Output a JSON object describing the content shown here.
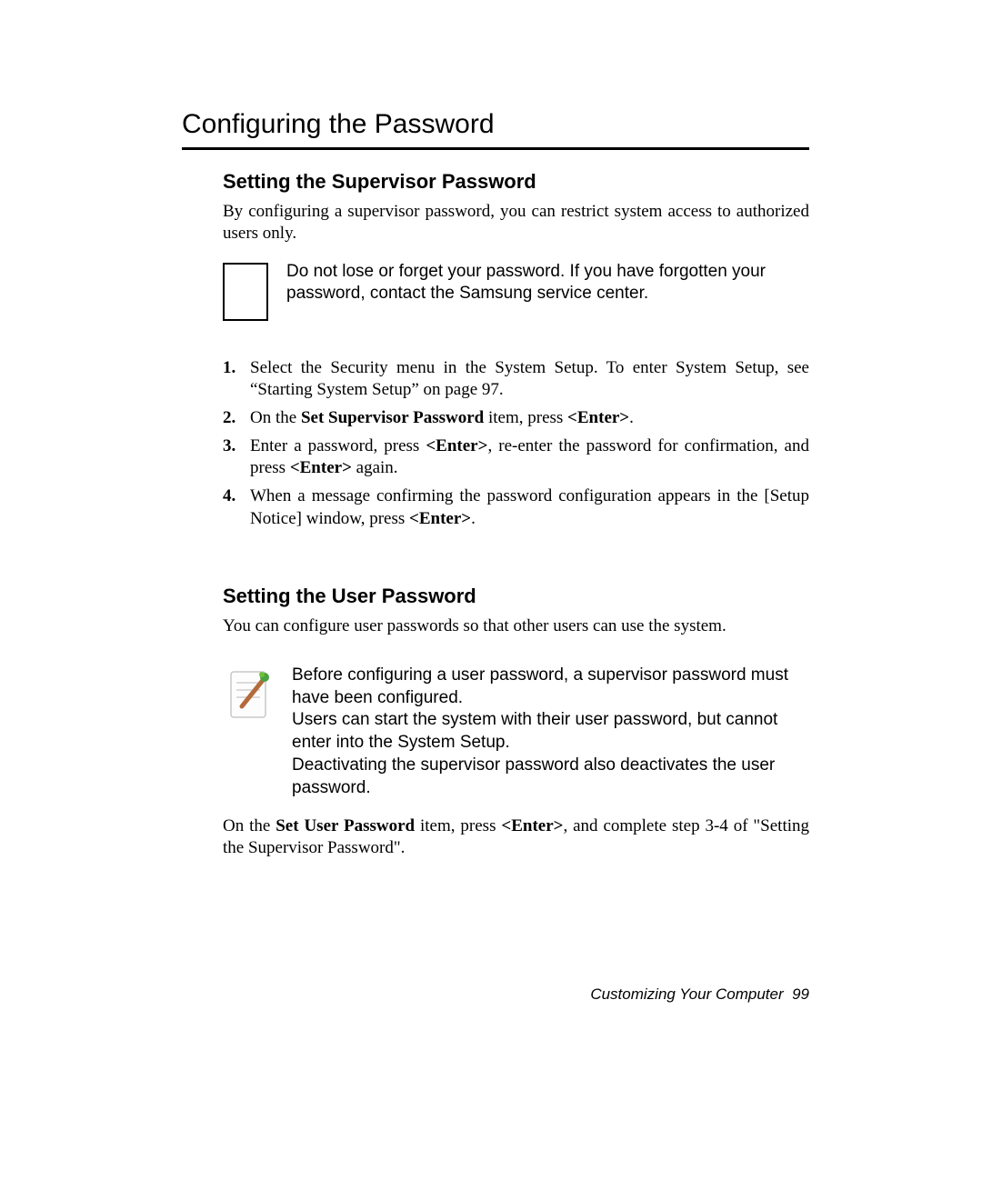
{
  "title": "Configuring the Password",
  "section1": {
    "heading": "Setting the Supervisor Password",
    "intro": "By configuring a supervisor password, you can restrict system access to authorized users only.",
    "note": "Do not lose or forget your password. If you have forgotten your password, contact the Samsung service center.",
    "steps": {
      "n1": "1.",
      "s1": "Select the Security menu in the System Setup. To enter System Setup, see “Starting System Setup” on page 97.",
      "n2": "2.",
      "s2a": "On the ",
      "s2b": "Set Supervisor Password",
      "s2c": " item, press ",
      "s2d": "<Enter>",
      "s2e": ".",
      "n3": "3.",
      "s3a": "Enter a password, press ",
      "s3b": "<Enter>",
      "s3c": ", re-enter the password for confirmation, and press ",
      "s3d": "<Enter>",
      "s3e": " again.",
      "n4": "4.",
      "s4a": "When a message confirming the password configuration appears in the [Setup Notice] window, press ",
      "s4b": "<Enter>",
      "s4c": "."
    }
  },
  "section2": {
    "heading": "Setting the User Password",
    "intro": "You can configure user passwords so that other users can use the system.",
    "note_p1": "Before configuring a user password, a supervisor password must have been configured.",
    "note_p2": "Users can start the system with their user password, but cannot enter into the System Setup.",
    "note_p3": "Deactivating the supervisor password also deactivates the user password.",
    "closing_a": "On the ",
    "closing_b": "Set User Password",
    "closing_c": " item, press ",
    "closing_d": "<Enter>",
    "closing_e": ", and complete step 3-4 of \"Setting the Supervisor Password\"."
  },
  "footer": {
    "chapter": "Customizing Your Computer",
    "page": "99"
  }
}
